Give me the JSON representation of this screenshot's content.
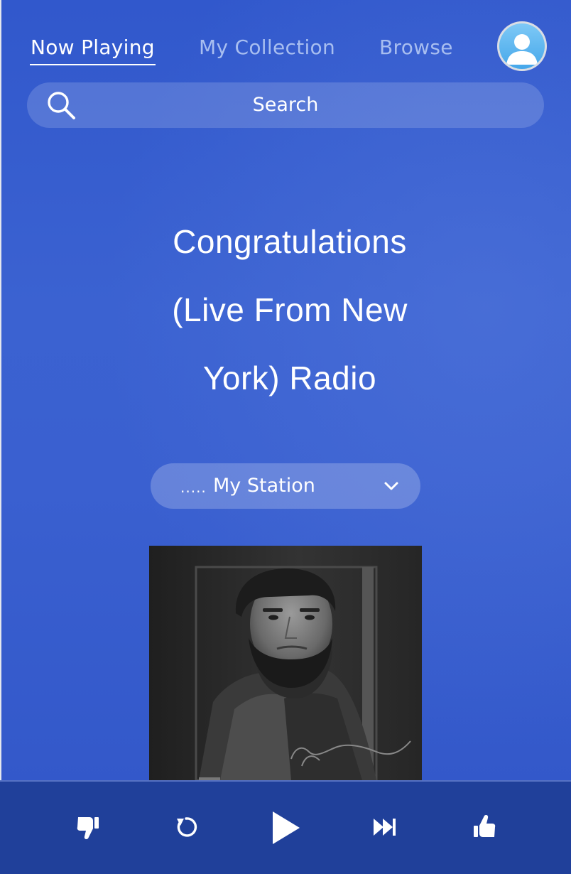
{
  "nav": {
    "tabs": [
      {
        "label": "Now Playing",
        "active": true
      },
      {
        "label": "My Collection",
        "active": false
      },
      {
        "label": "Browse",
        "active": false
      }
    ],
    "avatar_icon": "user-avatar-icon"
  },
  "search": {
    "placeholder": "Search",
    "icon": "search-icon"
  },
  "station": {
    "title_lines": [
      "Congratulations",
      "(Live From New",
      "York) Radio"
    ],
    "dots": ".....",
    "selector_label": "My Station",
    "selector_icon": "chevron-down-icon"
  },
  "player": {
    "controls": [
      "thumbs-down-icon",
      "replay-icon",
      "play-icon",
      "skip-forward-icon",
      "thumbs-up-icon"
    ]
  },
  "colors": {
    "background": "#3b62d1",
    "player_bar": "#20409a",
    "inactive_tab": "#a8bef0",
    "text": "#ffffff"
  }
}
